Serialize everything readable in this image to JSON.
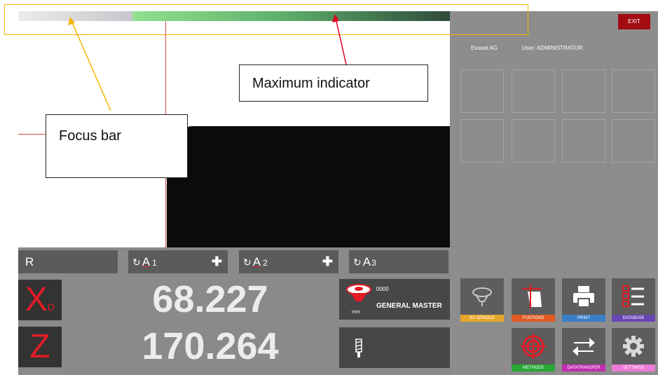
{
  "header": {
    "company": "Evoset AG",
    "user": "User: ADMINISTRATOR",
    "exit_label": "EXIT"
  },
  "axes_bar": {
    "r_label": "R",
    "a1": {
      "prefix": "↻",
      "letter": "A",
      "index": "1"
    },
    "a2": {
      "prefix": "↻",
      "letter": "A",
      "index": "2"
    },
    "a3": {
      "prefix": "↻",
      "letter": "A",
      "index": "3"
    },
    "plus": "✚"
  },
  "readouts": {
    "x": {
      "axis": "X",
      "sub": "D",
      "value": "68.227"
    },
    "z": {
      "axis": "Z",
      "value": "170.264"
    }
  },
  "holder": {
    "code": "0000",
    "name": "GENERAL MASTER",
    "unit": "mm"
  },
  "functions": [
    {
      "label": "KV SPINDLE",
      "icon": "spindle-icon",
      "color": "#e7a72a"
    },
    {
      "label": "FUNTIONS",
      "icon": "functions-icon",
      "color": "#e25a22"
    },
    {
      "label": "PRINT",
      "icon": "print-icon",
      "color": "#3a7fc4"
    },
    {
      "label": "DATABASE",
      "icon": "database-icon",
      "color": "#6a46b3"
    },
    {
      "label": "METHODS",
      "icon": "methods-icon",
      "color": "#27a836"
    },
    {
      "label": "DATATRANSFER",
      "icon": "transfer-icon",
      "color": "#c12eb0"
    },
    {
      "label": "SETTINGS",
      "icon": "gear-icon",
      "color": "#ec7ad8"
    }
  ],
  "annotations": {
    "focus": "Focus bar",
    "maximum": "Maximum indicator"
  },
  "colors": {
    "accent_red": "#e21b24",
    "exit_red": "#a30d12",
    "annotation_yellow": "#f5b300",
    "annotation_arrow_red": "#e0001b"
  }
}
